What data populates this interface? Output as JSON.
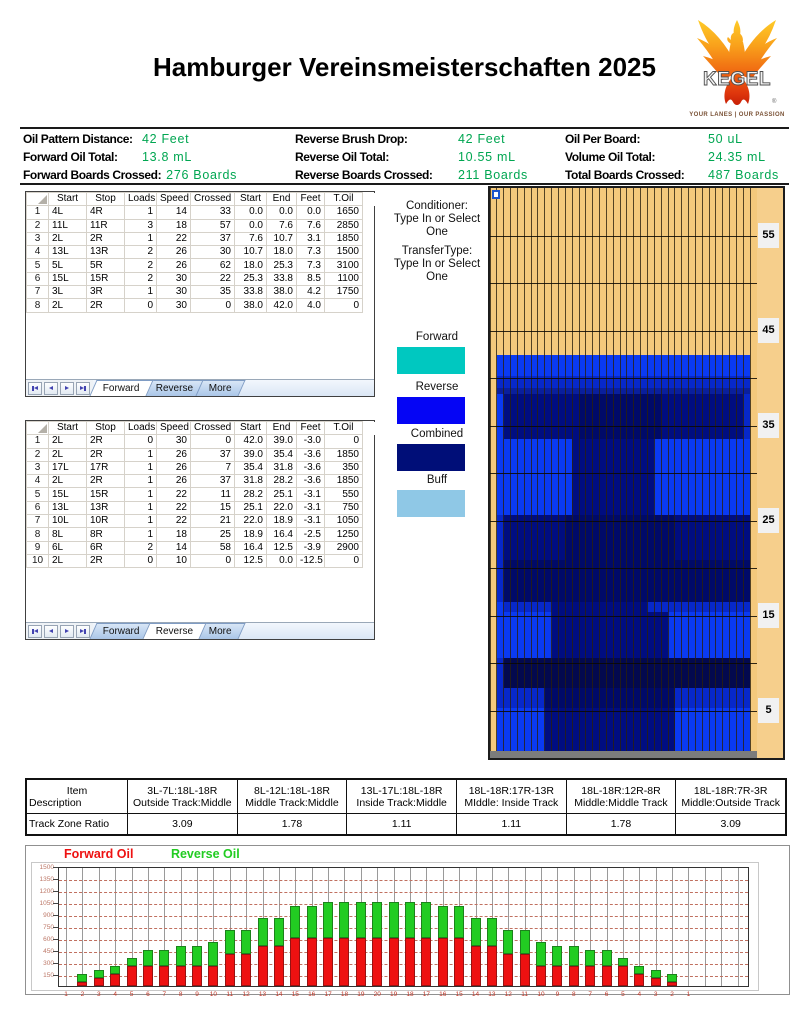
{
  "header": {
    "title": "Hamburger Vereinsmeisterschaften 2025",
    "logo": {
      "brand": "KEGEL",
      "tagline": "YOUR LANES | OUR PASSION"
    }
  },
  "stats": {
    "columns": [
      [
        {
          "label": "Oil Pattern Distance:",
          "value": "42 Feet"
        },
        {
          "label": "Forward Oil Total:",
          "value": "13.8 mL"
        },
        {
          "label": "Forward Boards Crossed:",
          "value": "276 Boards"
        }
      ],
      [
        {
          "label": "Reverse Brush Drop:",
          "value": "42 Feet"
        },
        {
          "label": "Reverse Oil Total:",
          "value": "10.55 mL"
        },
        {
          "label": "Reverse Boards Crossed:",
          "value": "211 Boards"
        }
      ],
      [
        {
          "label": "Oil Per Board:",
          "value": "50 uL"
        },
        {
          "label": "Volume Oil Total:",
          "value": "24.35 mL"
        },
        {
          "label": "Total Boards Crossed:",
          "value": "487 Boards"
        }
      ]
    ],
    "value_color": "#00A651"
  },
  "tables": {
    "columns": [
      "Start",
      "Stop",
      "Loads",
      "Speed",
      "Crossed",
      "Start",
      "End",
      "Feet",
      "T.Oil"
    ],
    "tabs": [
      "Forward",
      "Reverse",
      "More"
    ],
    "forward": {
      "active_tab": "Forward",
      "rows": [
        [
          "4L",
          "4R",
          "1",
          "14",
          "33",
          "0.0",
          "0.0",
          "0.0",
          "1650"
        ],
        [
          "11L",
          "11R",
          "3",
          "18",
          "57",
          "0.0",
          "7.6",
          "7.6",
          "2850"
        ],
        [
          "2L",
          "2R",
          "1",
          "22",
          "37",
          "7.6",
          "10.7",
          "3.1",
          "1850"
        ],
        [
          "13L",
          "13R",
          "2",
          "26",
          "30",
          "10.7",
          "18.0",
          "7.3",
          "1500"
        ],
        [
          "5L",
          "5R",
          "2",
          "26",
          "62",
          "18.0",
          "25.3",
          "7.3",
          "3100"
        ],
        [
          "15L",
          "15R",
          "2",
          "30",
          "22",
          "25.3",
          "33.8",
          "8.5",
          "1100"
        ],
        [
          "3L",
          "3R",
          "1",
          "30",
          "35",
          "33.8",
          "38.0",
          "4.2",
          "1750"
        ],
        [
          "2L",
          "2R",
          "0",
          "30",
          "0",
          "38.0",
          "42.0",
          "4.0",
          "0"
        ]
      ]
    },
    "reverse": {
      "active_tab": "Reverse",
      "rows": [
        [
          "2L",
          "2R",
          "0",
          "30",
          "0",
          "42.0",
          "39.0",
          "-3.0",
          "0"
        ],
        [
          "2L",
          "2R",
          "1",
          "26",
          "37",
          "39.0",
          "35.4",
          "-3.6",
          "1850"
        ],
        [
          "17L",
          "17R",
          "1",
          "26",
          "7",
          "35.4",
          "31.8",
          "-3.6",
          "350"
        ],
        [
          "2L",
          "2R",
          "1",
          "26",
          "37",
          "31.8",
          "28.2",
          "-3.6",
          "1850"
        ],
        [
          "15L",
          "15R",
          "1",
          "22",
          "11",
          "28.2",
          "25.1",
          "-3.1",
          "550"
        ],
        [
          "13L",
          "13R",
          "1",
          "22",
          "15",
          "25.1",
          "22.0",
          "-3.1",
          "750"
        ],
        [
          "10L",
          "10R",
          "1",
          "22",
          "21",
          "22.0",
          "18.9",
          "-3.1",
          "1050"
        ],
        [
          "8L",
          "8R",
          "1",
          "18",
          "25",
          "18.9",
          "16.4",
          "-2.5",
          "1250"
        ],
        [
          "6L",
          "6R",
          "2",
          "14",
          "58",
          "16.4",
          "12.5",
          "-3.9",
          "2900"
        ],
        [
          "2L",
          "2R",
          "0",
          "10",
          "0",
          "12.5",
          "0.0",
          "-12.5",
          "0"
        ]
      ]
    }
  },
  "annotations": {
    "conditioner_label": "Conditioner:",
    "conditioner_value": "Type In or Select One",
    "transfer_label": "TransferType:",
    "transfer_value": "Type In or Select One"
  },
  "legend": [
    {
      "label": "Forward",
      "color": "#00C8C0"
    },
    {
      "label": "Reverse",
      "color": "#0505F5"
    },
    {
      "label": "Combined",
      "color": "#000E78"
    },
    {
      "label": "Buff",
      "color": "#8FC8E6"
    }
  ],
  "lane": {
    "ruler_labels": [
      55,
      45,
      35,
      25,
      15,
      5
    ],
    "boards": 39,
    "feet_max": 60,
    "palette": {
      "bright": "#0A3AF2",
      "med": "#0728CA",
      "mdk": "#0A1F9C",
      "navy": "#000D80",
      "dark": "#000A68",
      "darkest": "#03094E"
    },
    "bands": [
      {
        "top": 42.4,
        "bot": 40.2,
        "segs": [
          [
            2,
            38,
            "bright"
          ]
        ]
      },
      {
        "top": 40.2,
        "bot": 39.0,
        "segs": [
          [
            2,
            38,
            "med"
          ]
        ]
      },
      {
        "top": 39.0,
        "bot": 38.3,
        "segs": [
          [
            2,
            38,
            "mdk"
          ]
        ]
      },
      {
        "top": 38.3,
        "bot": 33.6,
        "segs": [
          [
            2,
            38,
            "navy"
          ],
          [
            2,
            2,
            "bright"
          ],
          [
            38,
            38,
            "med"
          ],
          [
            14,
            25,
            "dark"
          ]
        ]
      },
      {
        "top": 33.6,
        "bot": 25.6,
        "segs": [
          [
            2,
            12,
            "bright"
          ],
          [
            13,
            24,
            "navy"
          ],
          [
            25,
            38,
            "bright"
          ]
        ]
      },
      {
        "top": 25.6,
        "bot": 20.8,
        "segs": [
          [
            2,
            38,
            "navy"
          ],
          [
            2,
            2,
            "med"
          ],
          [
            12,
            27,
            "dark"
          ]
        ]
      },
      {
        "top": 20.8,
        "bot": 16.4,
        "segs": [
          [
            2,
            38,
            "dark"
          ],
          [
            2,
            2,
            "med"
          ]
        ]
      },
      {
        "top": 16.4,
        "bot": 15.4,
        "segs": [
          [
            2,
            38,
            "navy"
          ],
          [
            3,
            9,
            "med"
          ],
          [
            24,
            36,
            "med"
          ],
          [
            2,
            2,
            "bright"
          ],
          [
            37,
            38,
            "med"
          ]
        ]
      },
      {
        "top": 15.4,
        "bot": 10.5,
        "segs": [
          [
            2,
            9,
            "bright"
          ],
          [
            10,
            26,
            "navy"
          ],
          [
            27,
            38,
            "bright"
          ]
        ]
      },
      {
        "top": 10.5,
        "bot": 7.4,
        "segs": [
          [
            2,
            38,
            "darkest"
          ],
          [
            2,
            2,
            "med"
          ]
        ]
      },
      {
        "top": 7.4,
        "bot": 5.3,
        "segs": [
          [
            2,
            8,
            "med"
          ],
          [
            9,
            27,
            "dark"
          ],
          [
            28,
            38,
            "med"
          ]
        ]
      },
      {
        "top": 5.3,
        "bot": 0.4,
        "segs": [
          [
            2,
            8,
            "bright"
          ],
          [
            9,
            27,
            "navy"
          ],
          [
            28,
            38,
            "bright"
          ]
        ]
      }
    ]
  },
  "ratio_table": {
    "item_label": "Item",
    "description_label": "Description",
    "ratio_label": "Track Zone Ratio",
    "columns": [
      {
        "item": "3L-7L:18L-18R",
        "description": "Outside Track:Middle",
        "ratio": "3.09"
      },
      {
        "item": "8L-12L:18L-18R",
        "description": "Middle Track:Middle",
        "ratio": "1.78"
      },
      {
        "item": "13L-17L:18L-18R",
        "description": "Inside Track:Middle",
        "ratio": "1.11"
      },
      {
        "item": "18L-18R:17R-13R",
        "description": "MIddle: Inside Track",
        "ratio": "1.11"
      },
      {
        "item": "18L-18R:12R-8R",
        "description": "Middle:Middle Track",
        "ratio": "1.78"
      },
      {
        "item": "18L-18R:7R-3R",
        "description": "Middle:Outside Track",
        "ratio": "3.09"
      }
    ]
  },
  "chart_data": {
    "type": "bar",
    "stacked": true,
    "legend_position": "top-left",
    "ylim": [
      0,
      1500
    ],
    "ytick_step": 150,
    "yticks": [
      150,
      300,
      450,
      600,
      750,
      900,
      1050,
      1200,
      1350,
      1500
    ],
    "x_labels": [
      "1",
      "2",
      "3",
      "4",
      "5",
      "6",
      "7",
      "8",
      "9",
      "10",
      "11",
      "12",
      "13",
      "14",
      "15",
      "16",
      "17",
      "18",
      "19",
      "20",
      "19",
      "18",
      "17",
      "16",
      "15",
      "14",
      "13",
      "12",
      "11",
      "10",
      "9",
      "8",
      "7",
      "6",
      "5",
      "4",
      "3",
      "2",
      "1"
    ],
    "series": [
      {
        "name": "Forward Oil",
        "color": "#EE1111",
        "values": [
          0,
          50,
          100,
          150,
          250,
          250,
          250,
          250,
          250,
          250,
          400,
          400,
          500,
          500,
          600,
          600,
          600,
          600,
          600,
          600,
          600,
          600,
          600,
          600,
          600,
          500,
          500,
          400,
          400,
          250,
          250,
          250,
          250,
          250,
          250,
          150,
          100,
          50,
          0
        ]
      },
      {
        "name": "Reverse Oil",
        "color": "#22CC22",
        "values": [
          0,
          100,
          100,
          100,
          100,
          200,
          200,
          250,
          250,
          300,
          300,
          300,
          350,
          350,
          400,
          400,
          450,
          450,
          450,
          450,
          450,
          450,
          450,
          400,
          400,
          350,
          350,
          300,
          300,
          300,
          250,
          250,
          200,
          200,
          100,
          100,
          100,
          100,
          0
        ]
      }
    ]
  }
}
